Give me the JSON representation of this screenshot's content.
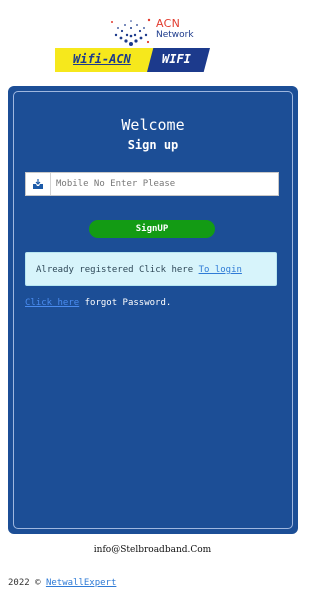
{
  "logo": {
    "line1": "ACN",
    "line2": "Network"
  },
  "banner": {
    "left_label": "Wifi-ACN",
    "right_label": "WIFI"
  },
  "card": {
    "title": "Welcome",
    "subtitle": "Sign up",
    "mobile_input": {
      "placeholder": "Mobile No Enter Please",
      "value": ""
    },
    "signup_button": "SignUP",
    "notice": {
      "text": "Already registered Click here ",
      "link": "To login"
    },
    "forgot": {
      "link": "Click here",
      "text": " forgot Password."
    }
  },
  "email": "info@Stelbroadband.Com",
  "footer": {
    "text": "2022 © ",
    "link": "NetwallExpert"
  },
  "colors": {
    "card": "#1c4e96",
    "button": "#139b14",
    "banner_yellow": "#f6e81c",
    "banner_blue": "#1c3a8c",
    "notice_bg": "#d7f4fb"
  },
  "icons": {
    "mobile_input_icon": "inbox-icon"
  }
}
